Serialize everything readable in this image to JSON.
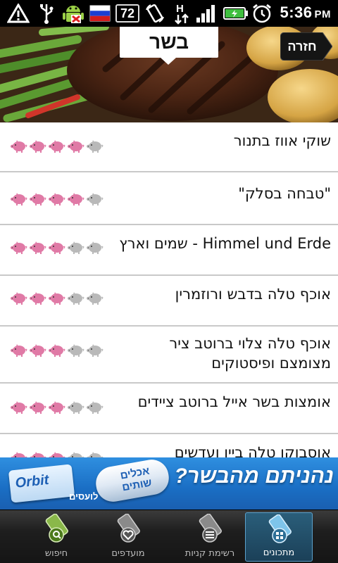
{
  "status_bar": {
    "icons": [
      "warning-icon",
      "usb-icon",
      "android-debug-icon",
      "flag-icon",
      "battery-percent-badge",
      "rotate-icon",
      "network-h-icon",
      "signal-icon",
      "battery-icon",
      "alarm-icon"
    ],
    "battery_badge": "72",
    "time": "5:36",
    "ampm": "PM"
  },
  "header": {
    "title": "בשר",
    "back_label": "חזרה"
  },
  "recipes": [
    {
      "title": "שוקי אווז בתנור",
      "rating": 4
    },
    {
      "title": "\"טבחה בסלק\"",
      "rating": 4
    },
    {
      "title": "Himmel und Erde - שמים וארץ",
      "rating": 3
    },
    {
      "title": "אוכף טלה בדבש ורוזמרין",
      "rating": 3
    },
    {
      "title": "אוכף טלה צלוי ברוטב ציר מצומצם ופיסטוקים",
      "rating": 3
    },
    {
      "title": "אומצות בשר אייל ברוטב ציידים",
      "rating": 3
    },
    {
      "title": "אוסבוקו טלה ביין ועדשים",
      "rating": 3
    }
  ],
  "banner": {
    "headline": "נהניתם מהבשר?",
    "tube_text_1": "אכלים",
    "tube_text_2": "שותים",
    "gum_label": "Orbit",
    "gum_brand": "לועסים"
  },
  "tabs": [
    {
      "label": "מתכונים",
      "icon": "recipes-grid-icon",
      "active": true
    },
    {
      "label": "רשימת קניות",
      "icon": "shopping-list-icon",
      "active": false
    },
    {
      "label": "מועדפים",
      "icon": "heart-favorites-icon",
      "active": false
    },
    {
      "label": "חיפוש",
      "icon": "search-icon",
      "active": false
    }
  ],
  "colors": {
    "pig_active": "#e07aa6",
    "pig_inactive": "#b9b9b9",
    "tab_active_bg": "#23516c",
    "banner_blue": "#1f75cc"
  }
}
